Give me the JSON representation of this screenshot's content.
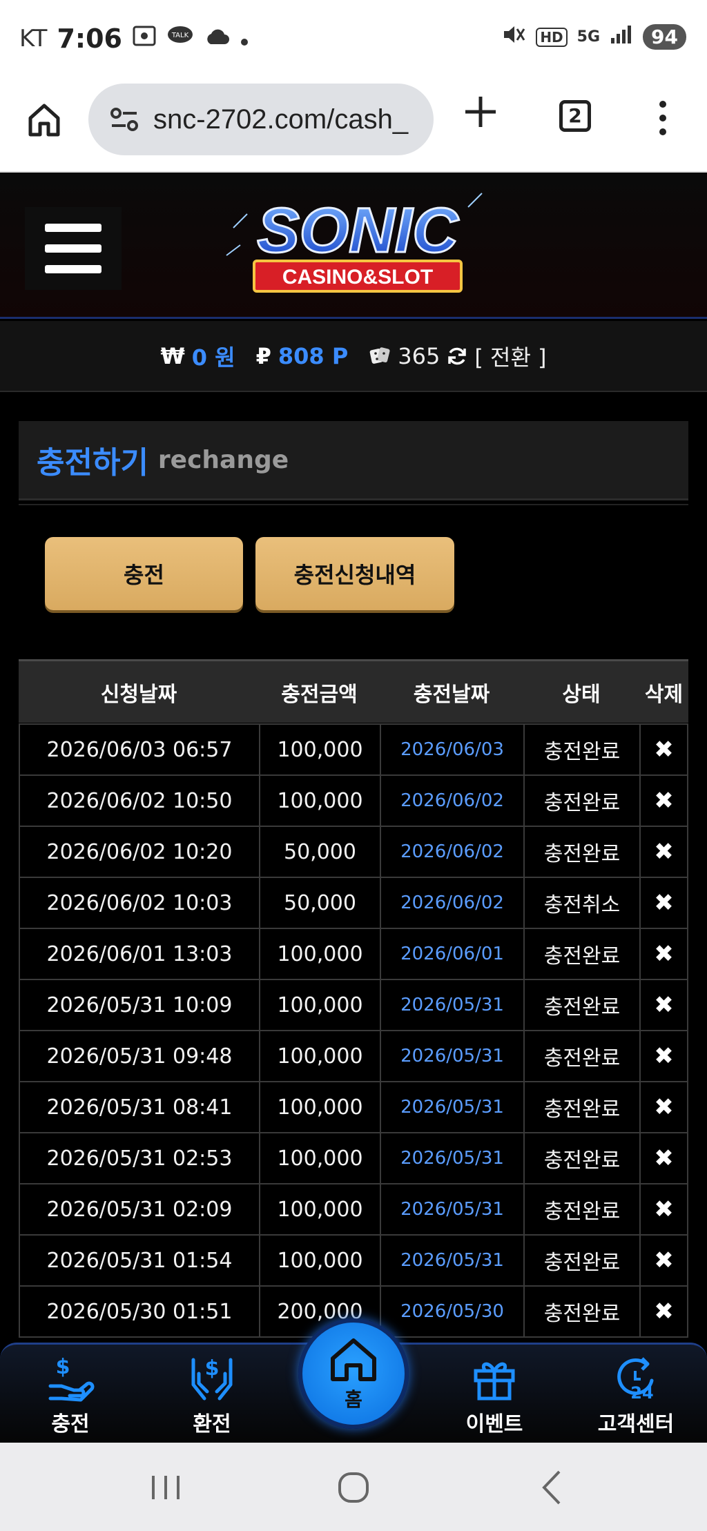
{
  "status_bar": {
    "carrier": "KT",
    "time": "7:06",
    "network": "5G",
    "hd": "HD",
    "battery": "94"
  },
  "browser": {
    "url": "snc-2702.com/cash_",
    "tab_count": "2"
  },
  "site": {
    "logo_main": "SONIC",
    "logo_sub": "CASINO&SLOT"
  },
  "balance": {
    "won_symbol": "₩",
    "won_value": "0 원",
    "point_symbol": "₽",
    "point_value": "808 P",
    "casino_value": "365",
    "switch_label": "[ 전환 ]"
  },
  "section": {
    "title_ko": "충전하기",
    "title_en": "rechange"
  },
  "buttons": {
    "charge": "충전",
    "history": "충전신청내역"
  },
  "table": {
    "headers": [
      "신청날짜",
      "충전금액",
      "충전날짜",
      "상태",
      "삭제"
    ],
    "rows": [
      {
        "requested": "2026/06/03 06:57",
        "amount": "100,000",
        "charged": "2026/06/03",
        "status": "충전완료",
        "delete": "✖"
      },
      {
        "requested": "2026/06/02 10:50",
        "amount": "100,000",
        "charged": "2026/06/02",
        "status": "충전완료",
        "delete": "✖"
      },
      {
        "requested": "2026/06/02 10:20",
        "amount": "50,000",
        "charged": "2026/06/02",
        "status": "충전완료",
        "delete": "✖"
      },
      {
        "requested": "2026/06/02 10:03",
        "amount": "50,000",
        "charged": "2026/06/02",
        "status": "충전취소",
        "delete": "✖"
      },
      {
        "requested": "2026/06/01 13:03",
        "amount": "100,000",
        "charged": "2026/06/01",
        "status": "충전완료",
        "delete": "✖"
      },
      {
        "requested": "2026/05/31 10:09",
        "amount": "100,000",
        "charged": "2026/05/31",
        "status": "충전완료",
        "delete": "✖"
      },
      {
        "requested": "2026/05/31 09:48",
        "amount": "100,000",
        "charged": "2026/05/31",
        "status": "충전완료",
        "delete": "✖"
      },
      {
        "requested": "2026/05/31 08:41",
        "amount": "100,000",
        "charged": "2026/05/31",
        "status": "충전완료",
        "delete": "✖"
      },
      {
        "requested": "2026/05/31 02:53",
        "amount": "100,000",
        "charged": "2026/05/31",
        "status": "충전완료",
        "delete": "✖"
      },
      {
        "requested": "2026/05/31 02:09",
        "amount": "100,000",
        "charged": "2026/05/31",
        "status": "충전완료",
        "delete": "✖"
      },
      {
        "requested": "2026/05/31 01:54",
        "amount": "100,000",
        "charged": "2026/05/31",
        "status": "충전완료",
        "delete": "✖"
      },
      {
        "requested": "2026/05/30 01:51",
        "amount": "200,000",
        "charged": "2026/05/30",
        "status": "충전완료",
        "delete": "✖"
      }
    ]
  },
  "bottom_nav": {
    "charge": "충전",
    "exchange": "환전",
    "home": "홈",
    "event": "이벤트",
    "support": "고객센터"
  },
  "colors": {
    "accent_blue": "#3b8cff",
    "button_gold": "#e2b66f",
    "home_blue": "#1a8cf0"
  }
}
